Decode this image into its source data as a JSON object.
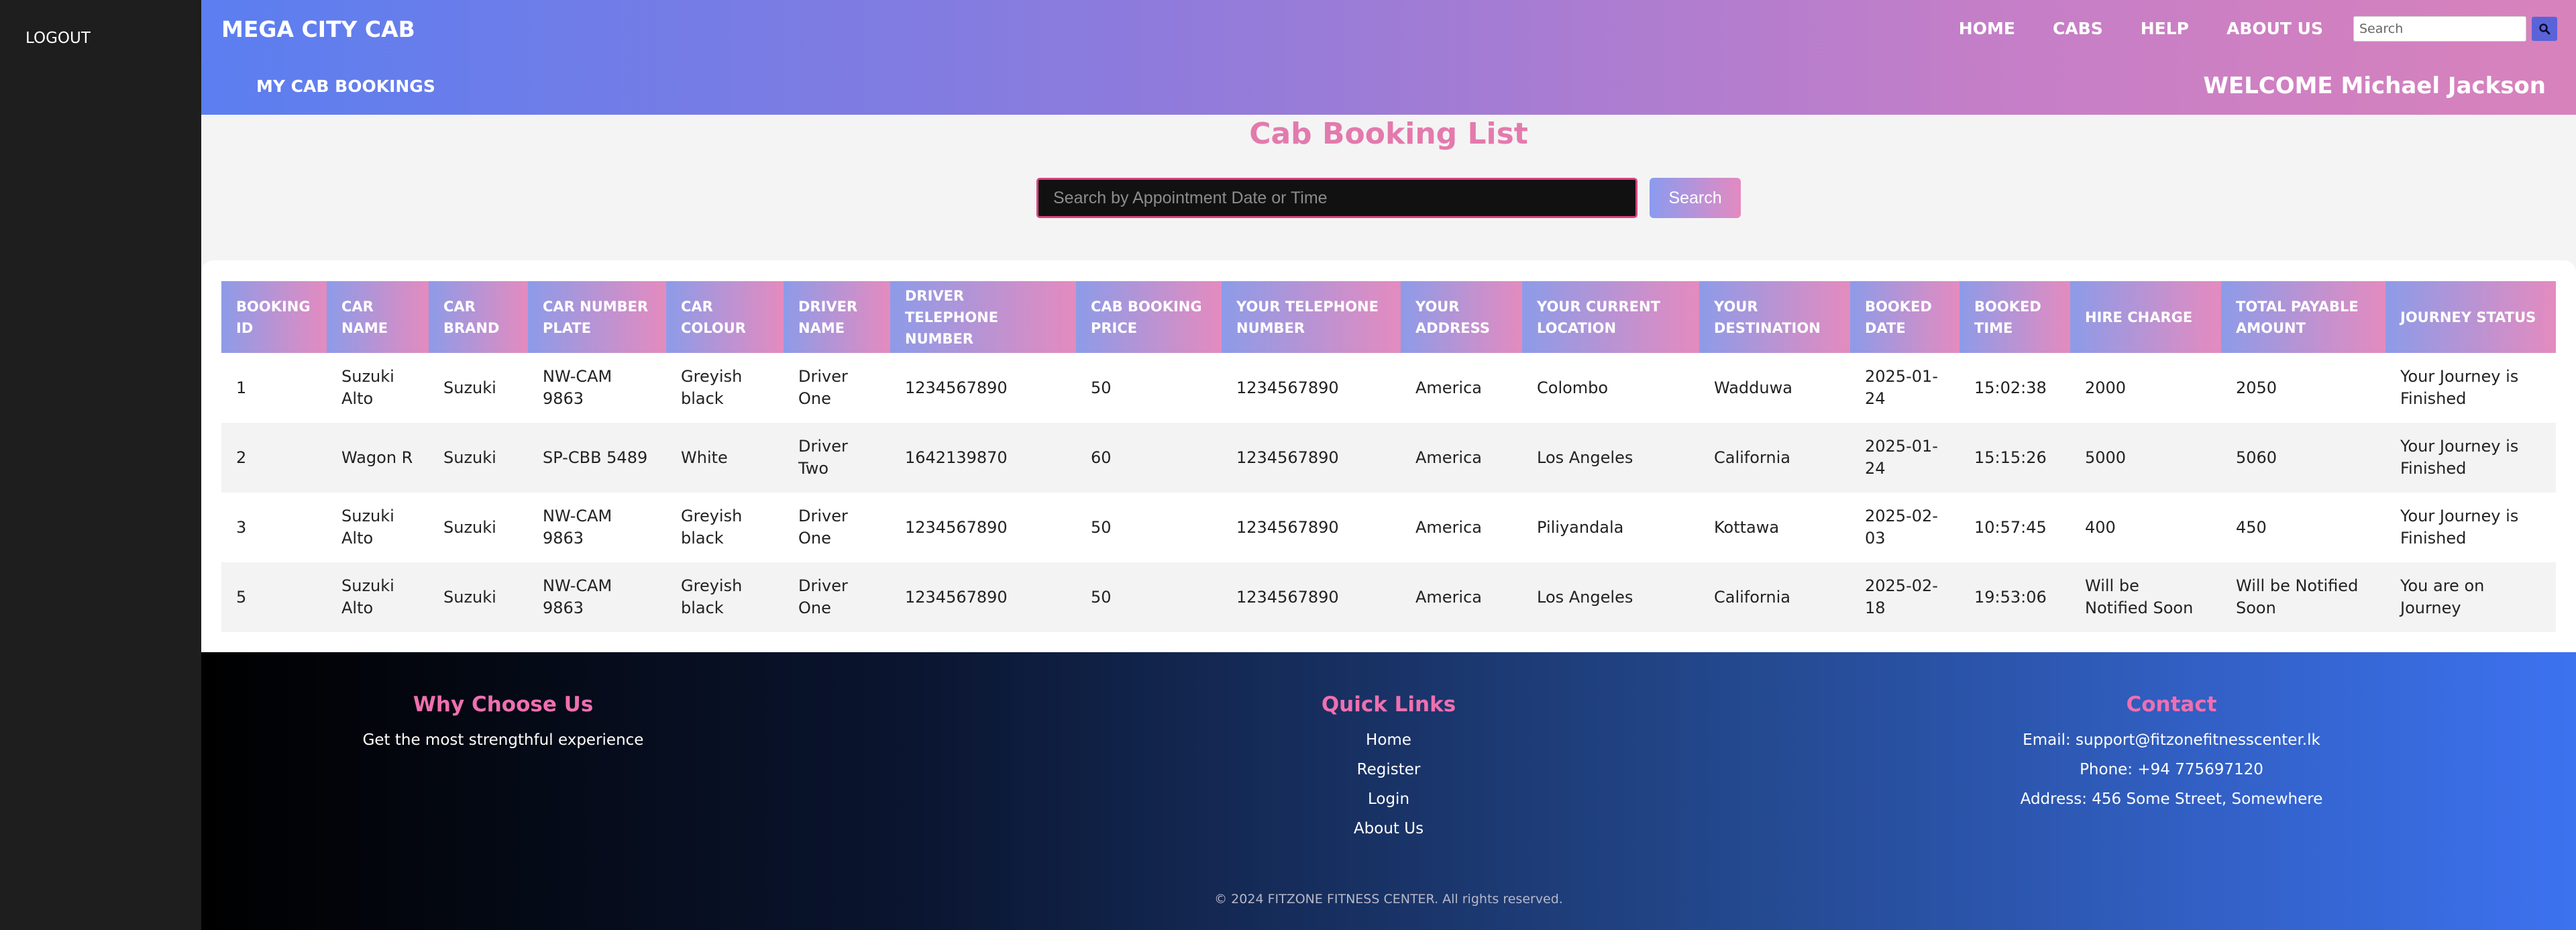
{
  "sidebar": {
    "logout_label": "LOGOUT"
  },
  "header": {
    "brand": "MEGA CITY CAB",
    "nav": [
      "HOME",
      "CABS",
      "HELP",
      "ABOUT US"
    ],
    "search_placeholder": "Search",
    "search_icon": "search-icon"
  },
  "subheader": {
    "my_bookings_label": "MY CAB BOOKINGS",
    "welcome_text": "WELCOME Michael Jackson"
  },
  "main": {
    "title": "Cab Booking List",
    "search_placeholder": "Search by Appointment Date or Time",
    "search_button": "Search"
  },
  "table": {
    "headers": [
      "BOOKING ID",
      "CAR NAME",
      "CAR BRAND",
      "CAR NUMBER PLATE",
      "CAR COLOUR",
      "DRIVER NAME",
      "DRIVER TELEPHONE NUMBER",
      "CAB BOOKING PRICE",
      "YOUR TELEPHONE NUMBER",
      "YOUR ADDRESS",
      "YOUR CURRENT LOCATION",
      "YOUR DESTINATION",
      "BOOKED DATE",
      "BOOKED TIME",
      "HIRE CHARGE",
      "TOTAL PAYABLE AMOUNT",
      "JOURNEY STATUS"
    ],
    "rows": [
      [
        "1",
        "Suzuki Alto",
        "Suzuki",
        "NW-CAM 9863",
        "Greyish black",
        "Driver One",
        "1234567890",
        "50",
        "1234567890",
        "America",
        "Colombo",
        "Wadduwa",
        "2025-01-24",
        "15:02:38",
        "2000",
        "2050",
        "Your Journey is Finished"
      ],
      [
        "2",
        "Wagon R",
        "Suzuki",
        "SP-CBB 5489",
        "White",
        "Driver Two",
        "1642139870",
        "60",
        "1234567890",
        "America",
        "Los Angeles",
        "California",
        "2025-01-24",
        "15:15:26",
        "5000",
        "5060",
        "Your Journey is Finished"
      ],
      [
        "3",
        "Suzuki Alto",
        "Suzuki",
        "NW-CAM 9863",
        "Greyish black",
        "Driver One",
        "1234567890",
        "50",
        "1234567890",
        "America",
        "Piliyandala",
        "Kottawa",
        "2025-02-03",
        "10:57:45",
        "400",
        "450",
        "Your Journey is Finished"
      ],
      [
        "5",
        "Suzuki Alto",
        "Suzuki",
        "NW-CAM 9863",
        "Greyish black",
        "Driver One",
        "1234567890",
        "50",
        "1234567890",
        "America",
        "Los Angeles",
        "California",
        "2025-02-18",
        "19:53:06",
        "Will be Notified Soon",
        "Will be Notified Soon",
        "You are on Journey"
      ]
    ]
  },
  "footer": {
    "why": {
      "title": "Why Choose Us",
      "text": "Get the most strengthful experience"
    },
    "quick_links": {
      "title": "Quick Links",
      "links": [
        "Home",
        "Register",
        "Login",
        "About Us"
      ]
    },
    "contact": {
      "title": "Contact",
      "email": "Email: support@fitzonefitnesscenter.lk",
      "phone": "Phone: +94 775697120",
      "address": "Address: 456 Some Street, Somewhere"
    },
    "copyright": "© 2024 FITZONE FITNESS CENTER. All rights reserved."
  },
  "colors": {
    "accent_pink": "#e37aad",
    "gradient_start": "#5b7ef0",
    "gradient_end": "#d882bc",
    "sidebar_bg": "#1e1e1e"
  }
}
